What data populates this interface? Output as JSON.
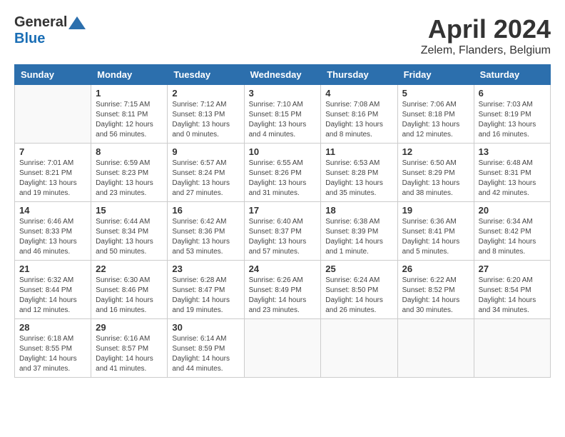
{
  "logo": {
    "general": "General",
    "blue": "Blue"
  },
  "title": "April 2024",
  "location": "Zelem, Flanders, Belgium",
  "weekdays": [
    "Sunday",
    "Monday",
    "Tuesday",
    "Wednesday",
    "Thursday",
    "Friday",
    "Saturday"
  ],
  "weeks": [
    [
      {
        "day": "",
        "sunrise": "",
        "sunset": "",
        "daylight": ""
      },
      {
        "day": "1",
        "sunrise": "Sunrise: 7:15 AM",
        "sunset": "Sunset: 8:11 PM",
        "daylight": "Daylight: 12 hours and 56 minutes."
      },
      {
        "day": "2",
        "sunrise": "Sunrise: 7:12 AM",
        "sunset": "Sunset: 8:13 PM",
        "daylight": "Daylight: 13 hours and 0 minutes."
      },
      {
        "day": "3",
        "sunrise": "Sunrise: 7:10 AM",
        "sunset": "Sunset: 8:15 PM",
        "daylight": "Daylight: 13 hours and 4 minutes."
      },
      {
        "day": "4",
        "sunrise": "Sunrise: 7:08 AM",
        "sunset": "Sunset: 8:16 PM",
        "daylight": "Daylight: 13 hours and 8 minutes."
      },
      {
        "day": "5",
        "sunrise": "Sunrise: 7:06 AM",
        "sunset": "Sunset: 8:18 PM",
        "daylight": "Daylight: 13 hours and 12 minutes."
      },
      {
        "day": "6",
        "sunrise": "Sunrise: 7:03 AM",
        "sunset": "Sunset: 8:19 PM",
        "daylight": "Daylight: 13 hours and 16 minutes."
      }
    ],
    [
      {
        "day": "7",
        "sunrise": "Sunrise: 7:01 AM",
        "sunset": "Sunset: 8:21 PM",
        "daylight": "Daylight: 13 hours and 19 minutes."
      },
      {
        "day": "8",
        "sunrise": "Sunrise: 6:59 AM",
        "sunset": "Sunset: 8:23 PM",
        "daylight": "Daylight: 13 hours and 23 minutes."
      },
      {
        "day": "9",
        "sunrise": "Sunrise: 6:57 AM",
        "sunset": "Sunset: 8:24 PM",
        "daylight": "Daylight: 13 hours and 27 minutes."
      },
      {
        "day": "10",
        "sunrise": "Sunrise: 6:55 AM",
        "sunset": "Sunset: 8:26 PM",
        "daylight": "Daylight: 13 hours and 31 minutes."
      },
      {
        "day": "11",
        "sunrise": "Sunrise: 6:53 AM",
        "sunset": "Sunset: 8:28 PM",
        "daylight": "Daylight: 13 hours and 35 minutes."
      },
      {
        "day": "12",
        "sunrise": "Sunrise: 6:50 AM",
        "sunset": "Sunset: 8:29 PM",
        "daylight": "Daylight: 13 hours and 38 minutes."
      },
      {
        "day": "13",
        "sunrise": "Sunrise: 6:48 AM",
        "sunset": "Sunset: 8:31 PM",
        "daylight": "Daylight: 13 hours and 42 minutes."
      }
    ],
    [
      {
        "day": "14",
        "sunrise": "Sunrise: 6:46 AM",
        "sunset": "Sunset: 8:33 PM",
        "daylight": "Daylight: 13 hours and 46 minutes."
      },
      {
        "day": "15",
        "sunrise": "Sunrise: 6:44 AM",
        "sunset": "Sunset: 8:34 PM",
        "daylight": "Daylight: 13 hours and 50 minutes."
      },
      {
        "day": "16",
        "sunrise": "Sunrise: 6:42 AM",
        "sunset": "Sunset: 8:36 PM",
        "daylight": "Daylight: 13 hours and 53 minutes."
      },
      {
        "day": "17",
        "sunrise": "Sunrise: 6:40 AM",
        "sunset": "Sunset: 8:37 PM",
        "daylight": "Daylight: 13 hours and 57 minutes."
      },
      {
        "day": "18",
        "sunrise": "Sunrise: 6:38 AM",
        "sunset": "Sunset: 8:39 PM",
        "daylight": "Daylight: 14 hours and 1 minute."
      },
      {
        "day": "19",
        "sunrise": "Sunrise: 6:36 AM",
        "sunset": "Sunset: 8:41 PM",
        "daylight": "Daylight: 14 hours and 5 minutes."
      },
      {
        "day": "20",
        "sunrise": "Sunrise: 6:34 AM",
        "sunset": "Sunset: 8:42 PM",
        "daylight": "Daylight: 14 hours and 8 minutes."
      }
    ],
    [
      {
        "day": "21",
        "sunrise": "Sunrise: 6:32 AM",
        "sunset": "Sunset: 8:44 PM",
        "daylight": "Daylight: 14 hours and 12 minutes."
      },
      {
        "day": "22",
        "sunrise": "Sunrise: 6:30 AM",
        "sunset": "Sunset: 8:46 PM",
        "daylight": "Daylight: 14 hours and 16 minutes."
      },
      {
        "day": "23",
        "sunrise": "Sunrise: 6:28 AM",
        "sunset": "Sunset: 8:47 PM",
        "daylight": "Daylight: 14 hours and 19 minutes."
      },
      {
        "day": "24",
        "sunrise": "Sunrise: 6:26 AM",
        "sunset": "Sunset: 8:49 PM",
        "daylight": "Daylight: 14 hours and 23 minutes."
      },
      {
        "day": "25",
        "sunrise": "Sunrise: 6:24 AM",
        "sunset": "Sunset: 8:50 PM",
        "daylight": "Daylight: 14 hours and 26 minutes."
      },
      {
        "day": "26",
        "sunrise": "Sunrise: 6:22 AM",
        "sunset": "Sunset: 8:52 PM",
        "daylight": "Daylight: 14 hours and 30 minutes."
      },
      {
        "day": "27",
        "sunrise": "Sunrise: 6:20 AM",
        "sunset": "Sunset: 8:54 PM",
        "daylight": "Daylight: 14 hours and 34 minutes."
      }
    ],
    [
      {
        "day": "28",
        "sunrise": "Sunrise: 6:18 AM",
        "sunset": "Sunset: 8:55 PM",
        "daylight": "Daylight: 14 hours and 37 minutes."
      },
      {
        "day": "29",
        "sunrise": "Sunrise: 6:16 AM",
        "sunset": "Sunset: 8:57 PM",
        "daylight": "Daylight: 14 hours and 41 minutes."
      },
      {
        "day": "30",
        "sunrise": "Sunrise: 6:14 AM",
        "sunset": "Sunset: 8:59 PM",
        "daylight": "Daylight: 14 hours and 44 minutes."
      },
      {
        "day": "",
        "sunrise": "",
        "sunset": "",
        "daylight": ""
      },
      {
        "day": "",
        "sunrise": "",
        "sunset": "",
        "daylight": ""
      },
      {
        "day": "",
        "sunrise": "",
        "sunset": "",
        "daylight": ""
      },
      {
        "day": "",
        "sunrise": "",
        "sunset": "",
        "daylight": ""
      }
    ]
  ]
}
